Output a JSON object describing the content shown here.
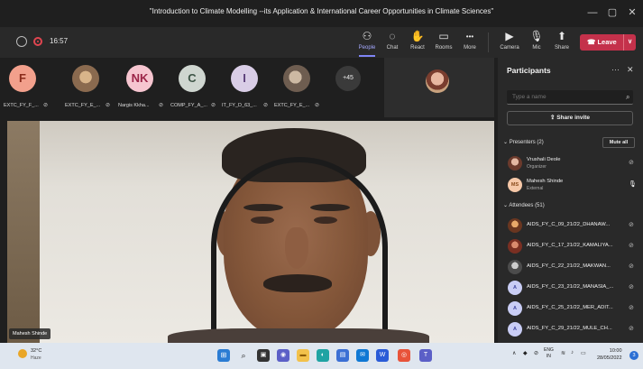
{
  "window": {
    "title": "\"Introduction to Climate Modelling --its Application & International Career Opportunities in Climate Sciences\"",
    "minimize_icon": "minimize-icon",
    "maximize_icon": "maximize-icon",
    "close_icon": "close-icon"
  },
  "toolbar": {
    "timer": "16:57",
    "buttons": [
      {
        "label": "People",
        "icon": "people-icon",
        "glyph": "⚇",
        "active": true
      },
      {
        "label": "Chat",
        "icon": "chat-icon",
        "glyph": "◌",
        "active": false
      },
      {
        "label": "React",
        "icon": "react-icon",
        "glyph": "✋",
        "active": false
      },
      {
        "label": "Rooms",
        "icon": "rooms-icon",
        "glyph": "▭",
        "active": false
      },
      {
        "label": "More",
        "icon": "more-icon",
        "glyph": "•••",
        "active": false
      },
      {
        "label": "Camera",
        "icon": "camera-off-icon",
        "glyph": "▶",
        "active": false
      },
      {
        "label": "Mic",
        "icon": "mic-off-icon",
        "glyph": "🎙",
        "active": false
      },
      {
        "label": "Share",
        "icon": "share-icon",
        "glyph": "⬆",
        "active": false
      }
    ],
    "leave_label": "Leave",
    "leave_color": "#c4314b"
  },
  "strip": {
    "tiles": [
      {
        "initials": "F",
        "name": "EXTC_FY_F_...",
        "bg": "#f2a08c",
        "fg": "#8a2c1b"
      },
      {
        "initials": "",
        "name": "EXTC_FY_E_...",
        "bg": "#a7876a",
        "fg": "#ffffff"
      },
      {
        "initials": "NK",
        "name": "Nargis Kkha...",
        "bg": "#f6c5d0",
        "fg": "#9b2347"
      },
      {
        "initials": "C",
        "name": "COMP_FY_A_...",
        "bg": "#cfd6d0",
        "fg": "#3d5446"
      },
      {
        "initials": "I",
        "name": "IT_FY_D_63_...",
        "bg": "#d9cde6",
        "fg": "#5b3f7a"
      },
      {
        "initials": "",
        "name": "EXTC_FY_E_...",
        "bg": "#8f7e70",
        "fg": "#ffffff"
      }
    ],
    "more_count": "+45"
  },
  "video": {
    "speaker_name": "Mahesh Shinde"
  },
  "panel": {
    "title": "Participants",
    "search_placeholder": "Type a name",
    "share_invite": "Share invite",
    "presenters_header": "Presenters (2)",
    "mute_all": "Mute all",
    "presenters": [
      {
        "name": "Vrushali Deole",
        "role": "Organizer",
        "initials": "",
        "bg": "#9a6b58",
        "fg": "#fff"
      },
      {
        "name": "Mahesh Shinde",
        "role": "External",
        "initials": "MS",
        "bg": "#f6c8a8",
        "fg": "#8a4b1b"
      }
    ],
    "attendees_header": "Attendees (51)",
    "attendees": [
      {
        "name": "AIDS_FY_C_09_21/22_DHANAW...",
        "initials": "",
        "bg": "#b36a3a",
        "fg": "#fff"
      },
      {
        "name": "AIDS_FY_C_17_21/22_KAMALIYA...",
        "initials": "",
        "bg": "#a14d3a",
        "fg": "#fff"
      },
      {
        "name": "AIDS_FY_C_22_21/22_MAKWAN...",
        "initials": "",
        "bg": "#6d6d6d",
        "fg": "#fff"
      },
      {
        "name": "AIDS_FY_C_23_21/22_MANASIA_...",
        "initials": "A",
        "bg": "#c9cdf5",
        "fg": "#3f46a0"
      },
      {
        "name": "AIDS_FY_C_25_21/22_MER_ADIT...",
        "initials": "A",
        "bg": "#c9cdf5",
        "fg": "#3f46a0"
      },
      {
        "name": "AIDS_FY_C_29_21/22_MULE_CH...",
        "initials": "A",
        "bg": "#c9cdf5",
        "fg": "#3f46a0"
      }
    ]
  },
  "taskbar": {
    "weather_temp": "32°C",
    "weather_desc": "Haze",
    "lang_top": "ENG",
    "lang_bottom": "IN",
    "time": "10:00",
    "date": "28/05/2022",
    "notifications": "3"
  }
}
